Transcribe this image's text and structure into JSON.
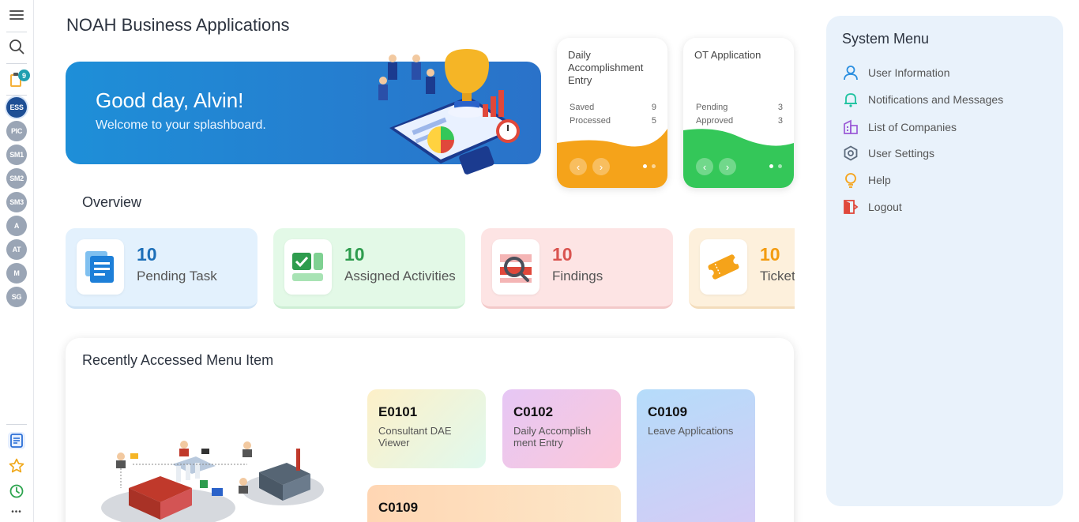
{
  "app": {
    "title": "NOAH Business Applications"
  },
  "rail": {
    "notif_badge": "9",
    "modules": [
      "ESS",
      "PIC",
      "SM1",
      "SM2",
      "SM3",
      "A",
      "AT",
      "M",
      "SG"
    ],
    "active_module": "ESS",
    "more": "•••"
  },
  "hero": {
    "greeting": "Good day, Alvin!",
    "subtitle": "Welcome to your splashboard."
  },
  "mini_cards": [
    {
      "title": "Daily Accomplishment Entry",
      "rows": [
        {
          "label": "Saved",
          "value": "9"
        },
        {
          "label": "Processed",
          "value": "5"
        }
      ],
      "accent": "#f5a31a"
    },
    {
      "title": "OT Application",
      "rows": [
        {
          "label": "Pending",
          "value": "3"
        },
        {
          "label": "Approved",
          "value": "3"
        }
      ],
      "accent": "#34c759"
    }
  ],
  "overview": {
    "title": "Overview",
    "cards": [
      {
        "count": "10",
        "label": "Pending Task",
        "icon": "document-stack-icon",
        "color": "#1d6fb8"
      },
      {
        "count": "10",
        "label": "Assigned Activities",
        "icon": "checklist-icon",
        "color": "#2e9c4e"
      },
      {
        "count": "10",
        "label": "Findings",
        "icon": "magnifier-icon",
        "color": "#d9534f"
      },
      {
        "count": "10",
        "label": "Tickets",
        "icon": "ticket-icon",
        "color": "#f39c12"
      }
    ]
  },
  "recent": {
    "title": "Recently Accessed Menu Item",
    "items": [
      {
        "code": "E0101",
        "name": "Consultant DAE Viewer"
      },
      {
        "code": "C0102",
        "name": "Daily Accomplish ment Entry"
      },
      {
        "code": "C0109",
        "name": "Leave Applications"
      },
      {
        "code": "C0109",
        "name": ""
      }
    ]
  },
  "system_menu": {
    "title": "System Menu",
    "items": [
      {
        "label": "User Information",
        "icon": "user-icon",
        "color": "#2b8fe0"
      },
      {
        "label": "Notifications and Messages",
        "icon": "bell-icon",
        "color": "#1fc3a0"
      },
      {
        "label": "List of Companies",
        "icon": "buildings-icon",
        "color": "#9b59d6"
      },
      {
        "label": "User Settings",
        "icon": "gear-icon",
        "color": "#5d6b7d"
      },
      {
        "label": "Help",
        "icon": "lightbulb-icon",
        "color": "#f5a31a"
      },
      {
        "label": "Logout",
        "icon": "logout-icon",
        "color": "#e0483b"
      }
    ]
  }
}
